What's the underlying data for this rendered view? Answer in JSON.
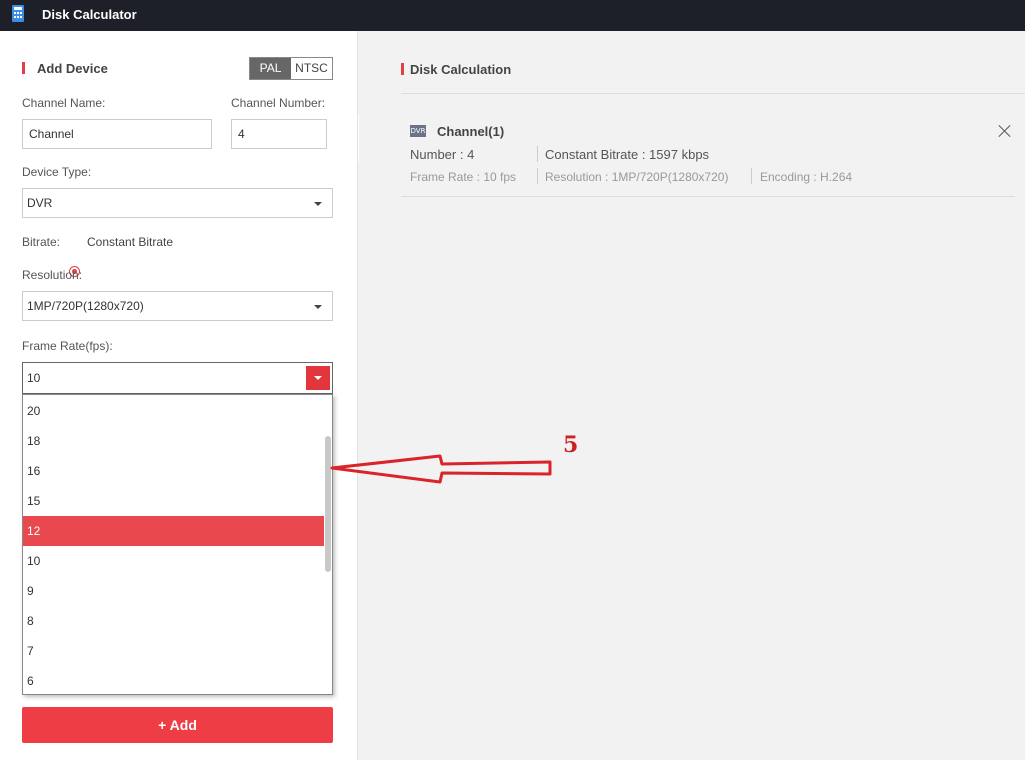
{
  "titlebar": {
    "title": "Disk Calculator",
    "icon": "calculator-icon"
  },
  "add_device": {
    "heading": "Add Device",
    "video_standard": {
      "options": [
        "PAL",
        "NTSC"
      ],
      "selected": "PAL"
    },
    "channel_name": {
      "label": "Channel Name:",
      "value": "Channel"
    },
    "channel_number": {
      "label": "Channel Number:",
      "value": "4"
    },
    "device_type": {
      "label": "Device Type:",
      "value": "DVR"
    },
    "bitrate": {
      "label": "Bitrate:",
      "option": "Constant Bitrate"
    },
    "resolution": {
      "label": "Resolution:",
      "value": "1MP/720P(1280x720)"
    },
    "frame_rate": {
      "label": "Frame Rate(fps):",
      "value": "10",
      "options": [
        "20",
        "18",
        "16",
        "15",
        "12",
        "10",
        "9",
        "8",
        "7",
        "6"
      ],
      "highlighted": "12"
    },
    "add_button": "+ Add"
  },
  "disk_calculation": {
    "heading": "Disk Calculation",
    "card": {
      "icon_text": "DVR",
      "title": "Channel(1)",
      "number": "Number : 4",
      "bitrate": "Constant Bitrate : 1597 kbps",
      "frame_rate": "Frame Rate : 10 fps",
      "resolution": "Resolution : 1MP/720P(1280x720)",
      "encoding": "Encoding : H.264"
    }
  },
  "annotation": {
    "label": "5",
    "color": "#cc2222"
  },
  "colors": {
    "accent": "#e04044",
    "titlebar": "#1d2029"
  }
}
